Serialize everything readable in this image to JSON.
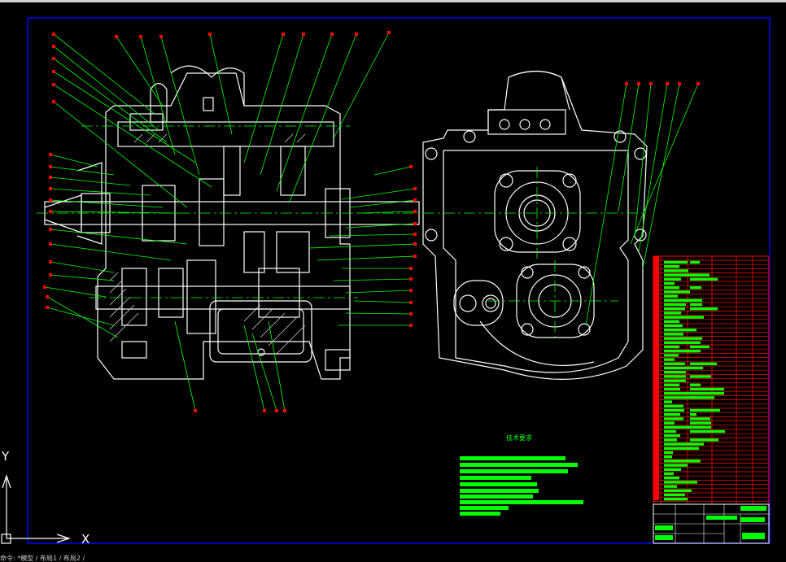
{
  "drawing": {
    "tech_requirements_title": "技术要求",
    "ucs_x_label": "X",
    "ucs_y_label": "Y",
    "command_line": "命令: *模型 / 布局1 / 布局2 /"
  },
  "colors": {
    "background": "#000000",
    "frame": "#0000ff",
    "geometry": "#ffffff",
    "leader": "#00ff00",
    "balloon": "#ff0000",
    "table_grid": "#ff0000",
    "table_text": "#00ff00"
  }
}
